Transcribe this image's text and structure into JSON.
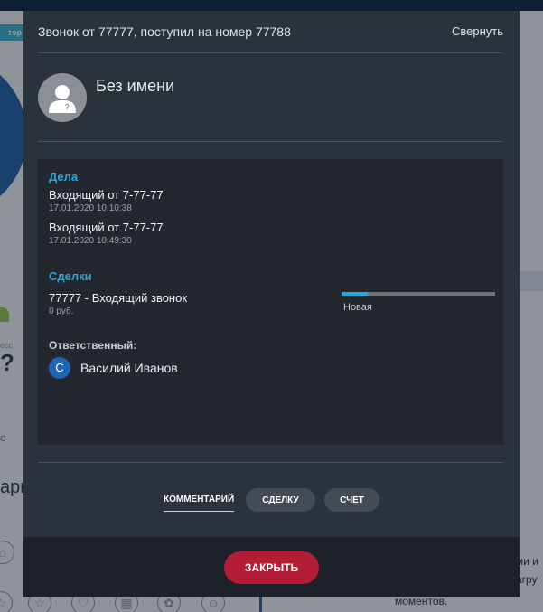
{
  "background": {
    "badge": "тор",
    "left_texts": [
      "есс",
      "?",
      "е",
      "арн"
    ],
    "right_texts": [
      "ми и",
      "агру",
      "моментов."
    ]
  },
  "modal": {
    "title": "Звонок от 77777, поступил на номер 77788",
    "collapse_label": "Свернуть",
    "contact_name": "Без имени",
    "tasks": {
      "title": "Дела",
      "items": [
        {
          "title": "Входящий от 7-77-77",
          "time": "17.01.2020 10:10:38"
        },
        {
          "title": "Входящий от 7-77-77",
          "time": "17.01.2020 10:49:30"
        }
      ]
    },
    "deals": {
      "title": "Сделки",
      "items": [
        {
          "title": "77777 - Входящий звонок",
          "amount": "0 руб.",
          "stage": "Новая",
          "progress": 0.17
        }
      ]
    },
    "responsible": {
      "label": "Ответственный:",
      "initial": "С",
      "name": "Василий Иванов"
    },
    "tabs": {
      "comment": "КОММЕНТАРИЙ",
      "deal": "СДЕЛКУ",
      "invoice": "СЧЕТ"
    },
    "close_label": "ЗАКРЫТЬ"
  },
  "colors": {
    "accent": "#2ba6d6",
    "close_button": "#b31d35",
    "modal_bg": "#2c323c",
    "panel_bg": "#23282f"
  }
}
